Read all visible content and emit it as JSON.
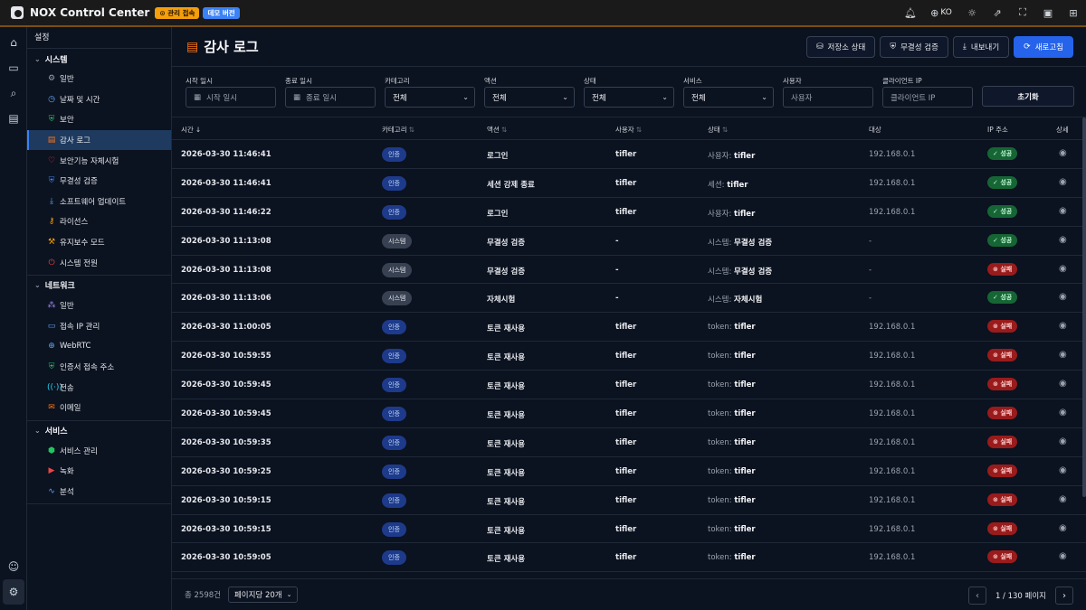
{
  "app": {
    "title": "NOX Control Center",
    "admin_badge": "관리 접속",
    "demo_badge": "데모 버전",
    "lang": "KO"
  },
  "sidebar": {
    "heading": "설정",
    "groups": [
      {
        "title": "시스템",
        "items": [
          "일반",
          "날짜 및 시간",
          "보안",
          "감사 로그",
          "보안기능 자체시험",
          "무결성 검증",
          "소프트웨어 업데이트",
          "라이선스",
          "유지보수 모드",
          "시스템 전원"
        ]
      },
      {
        "title": "네트워크",
        "items": [
          "일반",
          "접속 IP 관리",
          "WebRTC",
          "인증서 접속 주소",
          "전송",
          "이메일"
        ]
      },
      {
        "title": "서비스",
        "items": [
          "서비스 관리",
          "녹화",
          "분석"
        ]
      }
    ]
  },
  "page": {
    "title": "감사 로그"
  },
  "actions": {
    "storage": "저장소 상태",
    "integrity": "무결성 검증",
    "export": "내보내기",
    "refresh": "새로고침"
  },
  "filters": {
    "start_label": "시작 일시",
    "start_placeholder": "시작 일시",
    "end_label": "종료 일시",
    "end_placeholder": "종료 일시",
    "category_label": "카테고리",
    "category_value": "전체",
    "action_label": "액션",
    "action_value": "전체",
    "status_label": "상태",
    "status_value": "전체",
    "service_label": "서비스",
    "service_value": "전체",
    "user_label": "사용자",
    "user_placeholder": "사용자",
    "ip_label": "클라이언트 IP",
    "ip_placeholder": "클라이언트 IP",
    "reset": "초기화"
  },
  "table": {
    "headers": {
      "time": "시간",
      "category": "카테고리",
      "action": "액션",
      "user": "사용자",
      "status": "상태",
      "target": "대상",
      "ip": "IP 주소",
      "detail": "상세"
    },
    "rows": [
      {
        "time": "2026-03-30 11:46:41",
        "cat": "인증",
        "cat_type": "auth",
        "action": "로그인",
        "user": "tifler",
        "status_key": "사용자:",
        "status_val": "tifler",
        "target": "192.168.0.1",
        "result": "성공",
        "ok": true
      },
      {
        "time": "2026-03-30 11:46:41",
        "cat": "인증",
        "cat_type": "auth",
        "action": "세션 강제 종료",
        "user": "tifler",
        "status_key": "세션:",
        "status_val": "tifler",
        "target": "192.168.0.1",
        "result": "성공",
        "ok": true
      },
      {
        "time": "2026-03-30 11:46:22",
        "cat": "인증",
        "cat_type": "auth",
        "action": "로그인",
        "user": "tifler",
        "status_key": "사용자:",
        "status_val": "tifler",
        "target": "192.168.0.1",
        "result": "성공",
        "ok": true
      },
      {
        "time": "2026-03-30 11:13:08",
        "cat": "시스템",
        "cat_type": "sys",
        "action": "무결성 검증",
        "user": "-",
        "status_key": "시스템:",
        "status_val": "무결성 검증",
        "target": "-",
        "result": "성공",
        "ok": true
      },
      {
        "time": "2026-03-30 11:13:08",
        "cat": "시스템",
        "cat_type": "sys",
        "action": "무결성 검증",
        "user": "-",
        "status_key": "시스템:",
        "status_val": "무결성 검증",
        "target": "-",
        "result": "실패",
        "ok": false
      },
      {
        "time": "2026-03-30 11:13:06",
        "cat": "시스템",
        "cat_type": "sys",
        "action": "자체시험",
        "user": "-",
        "status_key": "시스템:",
        "status_val": "자체시험",
        "target": "-",
        "result": "성공",
        "ok": true
      },
      {
        "time": "2026-03-30 11:00:05",
        "cat": "인증",
        "cat_type": "auth",
        "action": "토큰 재사용",
        "user": "tifler",
        "status_key": "token:",
        "status_val": "tifler",
        "target": "192.168.0.1",
        "result": "실패",
        "ok": false
      },
      {
        "time": "2026-03-30 10:59:55",
        "cat": "인증",
        "cat_type": "auth",
        "action": "토큰 재사용",
        "user": "tifler",
        "status_key": "token:",
        "status_val": "tifler",
        "target": "192.168.0.1",
        "result": "실패",
        "ok": false
      },
      {
        "time": "2026-03-30 10:59:45",
        "cat": "인증",
        "cat_type": "auth",
        "action": "토큰 재사용",
        "user": "tifler",
        "status_key": "token:",
        "status_val": "tifler",
        "target": "192.168.0.1",
        "result": "실패",
        "ok": false
      },
      {
        "time": "2026-03-30 10:59:45",
        "cat": "인증",
        "cat_type": "auth",
        "action": "토큰 재사용",
        "user": "tifler",
        "status_key": "token:",
        "status_val": "tifler",
        "target": "192.168.0.1",
        "result": "실패",
        "ok": false
      },
      {
        "time": "2026-03-30 10:59:35",
        "cat": "인증",
        "cat_type": "auth",
        "action": "토큰 재사용",
        "user": "tifler",
        "status_key": "token:",
        "status_val": "tifler",
        "target": "192.168.0.1",
        "result": "실패",
        "ok": false
      },
      {
        "time": "2026-03-30 10:59:25",
        "cat": "인증",
        "cat_type": "auth",
        "action": "토큰 재사용",
        "user": "tifler",
        "status_key": "token:",
        "status_val": "tifler",
        "target": "192.168.0.1",
        "result": "실패",
        "ok": false
      },
      {
        "time": "2026-03-30 10:59:15",
        "cat": "인증",
        "cat_type": "auth",
        "action": "토큰 재사용",
        "user": "tifler",
        "status_key": "token:",
        "status_val": "tifler",
        "target": "192.168.0.1",
        "result": "실패",
        "ok": false
      },
      {
        "time": "2026-03-30 10:59:15",
        "cat": "인증",
        "cat_type": "auth",
        "action": "토큰 재사용",
        "user": "tifler",
        "status_key": "token:",
        "status_val": "tifler",
        "target": "192.168.0.1",
        "result": "실패",
        "ok": false
      },
      {
        "time": "2026-03-30 10:59:05",
        "cat": "인증",
        "cat_type": "auth",
        "action": "토큰 재사용",
        "user": "tifler",
        "status_key": "token:",
        "status_val": "tifler",
        "target": "192.168.0.1",
        "result": "실패",
        "ok": false
      }
    ]
  },
  "footer": {
    "total": "총 2598건",
    "per_page": "페이지당 20개",
    "page_info": "1 / 130 페이지"
  },
  "colors": {
    "accent": "#2563eb",
    "success": "#166534",
    "failure": "#991b1b",
    "admin_badge": "#f59e0b"
  }
}
